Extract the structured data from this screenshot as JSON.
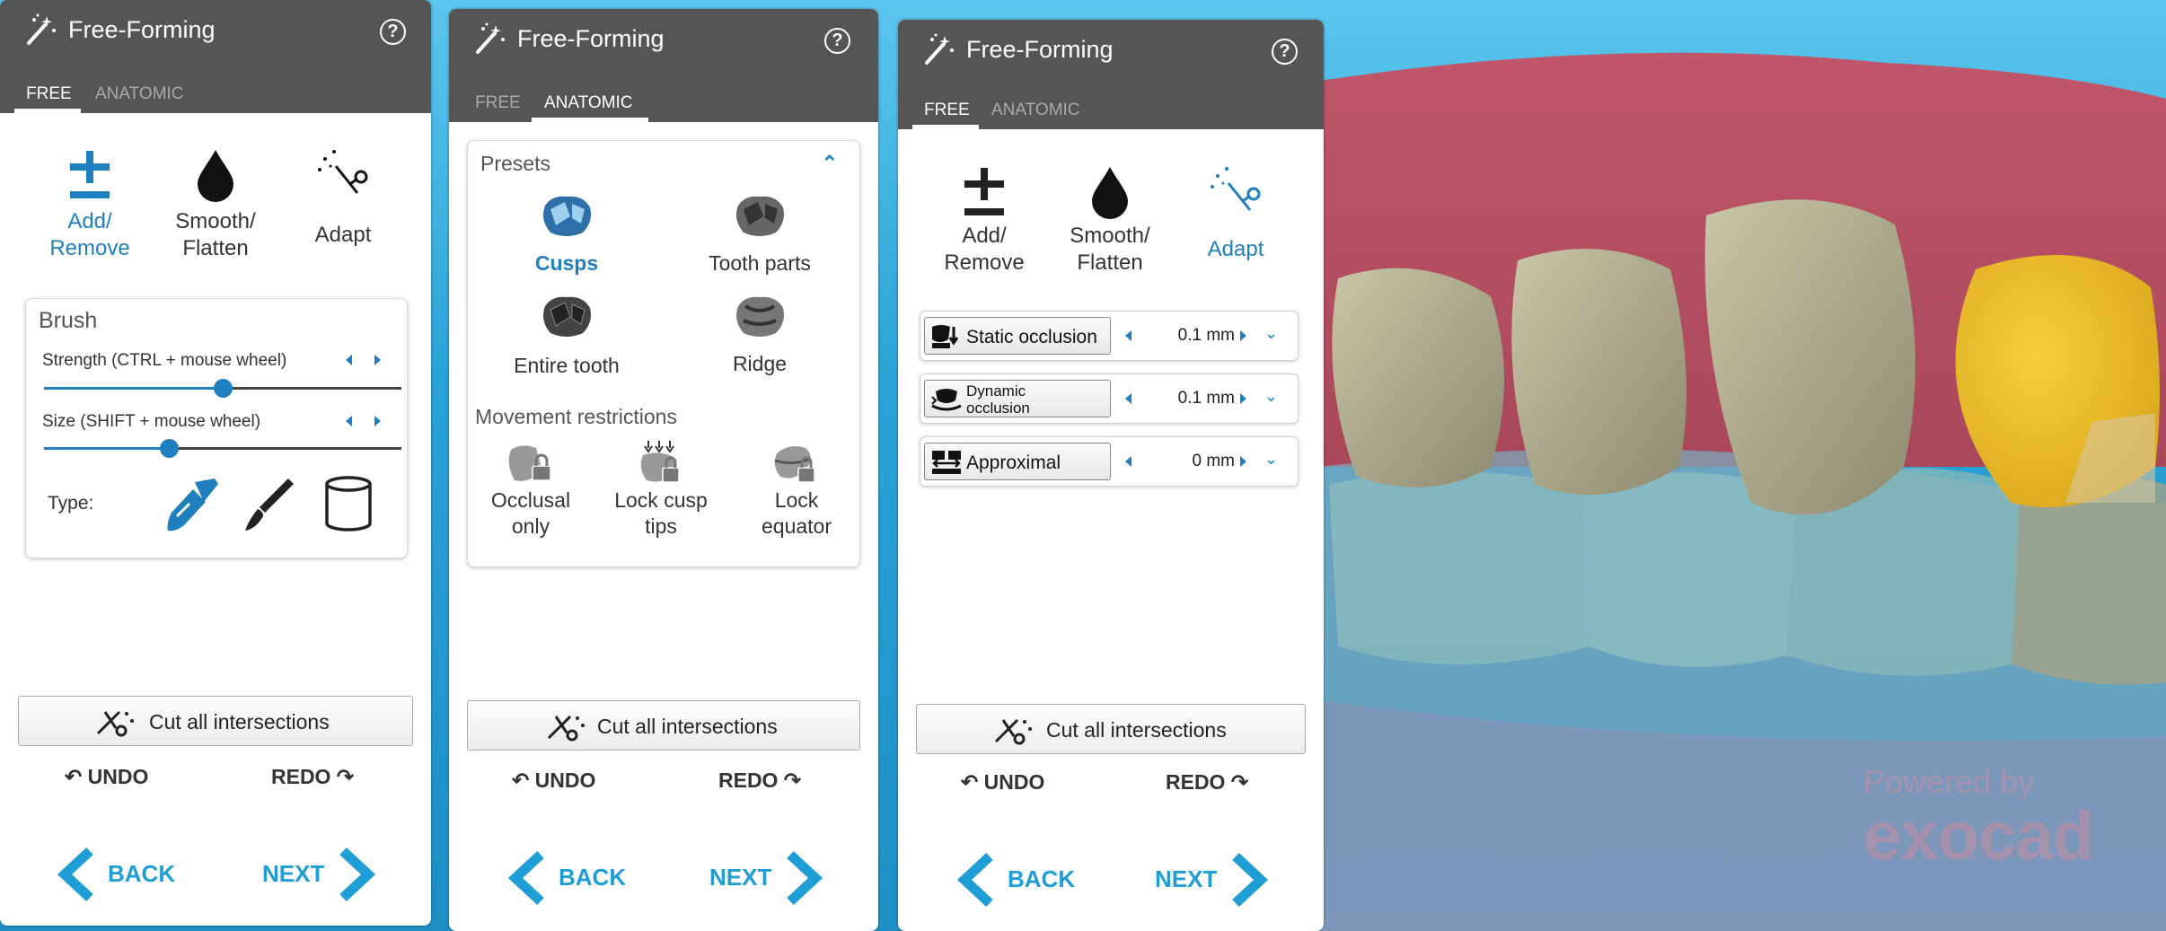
{
  "colors": {
    "accent": "#1f7fbf",
    "nav_accent": "#1f9ed6",
    "header_bg": "#555555",
    "crown": "#f2c230"
  },
  "panel_left": {
    "title": "Free-Forming",
    "tabs": [
      "FREE",
      "ANATOMIC"
    ],
    "active_tab": "FREE",
    "tools": [
      {
        "label_1": "Add/",
        "label_2": "Remove",
        "icon": "plus-minus-icon",
        "active": true
      },
      {
        "label_1": "Smooth/",
        "label_2": "Flatten",
        "icon": "drop-icon",
        "active": false
      },
      {
        "label_1": "Adapt",
        "icon": "adapt-wand-icon",
        "active": false
      }
    ],
    "brush": {
      "title": "Brush",
      "strength_label": "Strength (CTRL + mouse wheel)",
      "strength_value": 0.5,
      "size_label": "Size (SHIFT + mouse wheel)",
      "size_value": 0.35,
      "type_label": "Type:",
      "types": [
        "wide-brush-icon",
        "fine-brush-icon",
        "cylinder-icon"
      ]
    },
    "cut_label": "Cut all intersections",
    "undo": "UNDO",
    "redo": "REDO",
    "back": "BACK",
    "next": "NEXT"
  },
  "panel_middle": {
    "title": "Free-Forming",
    "tabs": [
      "FREE",
      "ANATOMIC"
    ],
    "active_tab": "ANATOMIC",
    "presets_title": "Presets",
    "presets": [
      {
        "label": "Cusps",
        "active": true
      },
      {
        "label": "Tooth parts",
        "active": false
      },
      {
        "label": "Entire tooth",
        "active": false
      },
      {
        "label": "Ridge",
        "active": false
      }
    ],
    "movement_title": "Movement restrictions",
    "restrictions": [
      {
        "label_1": "Occlusal",
        "label_2": "only"
      },
      {
        "label_1": "Lock cusp",
        "label_2": "tips"
      },
      {
        "label_1": "Lock",
        "label_2": "equator"
      }
    ],
    "cut_label": "Cut all intersections",
    "undo": "UNDO",
    "redo": "REDO",
    "back": "BACK",
    "next": "NEXT"
  },
  "panel_right": {
    "title": "Free-Forming",
    "tabs": [
      "FREE",
      "ANATOMIC"
    ],
    "active_tab": "FREE",
    "tools": [
      {
        "label_1": "Add/",
        "label_2": "Remove",
        "icon": "plus-minus-icon",
        "active": false
      },
      {
        "label_1": "Smooth/",
        "label_2": "Flatten",
        "icon": "drop-icon",
        "active": false
      },
      {
        "label_1": "Adapt",
        "icon": "adapt-wand-icon",
        "active": true
      }
    ],
    "options": [
      {
        "label": "Static occlusion",
        "value": "0.1 mm"
      },
      {
        "label_1": "Dynamic",
        "label_2": "occlusion",
        "value": "0.1 mm"
      },
      {
        "label": "Approximal",
        "value": "0 mm"
      }
    ],
    "cut_label": "Cut all intersections",
    "undo": "UNDO",
    "redo": "REDO",
    "back": "BACK",
    "next": "NEXT"
  },
  "watermark": {
    "line1": "Powered by",
    "line2": "exocad"
  }
}
